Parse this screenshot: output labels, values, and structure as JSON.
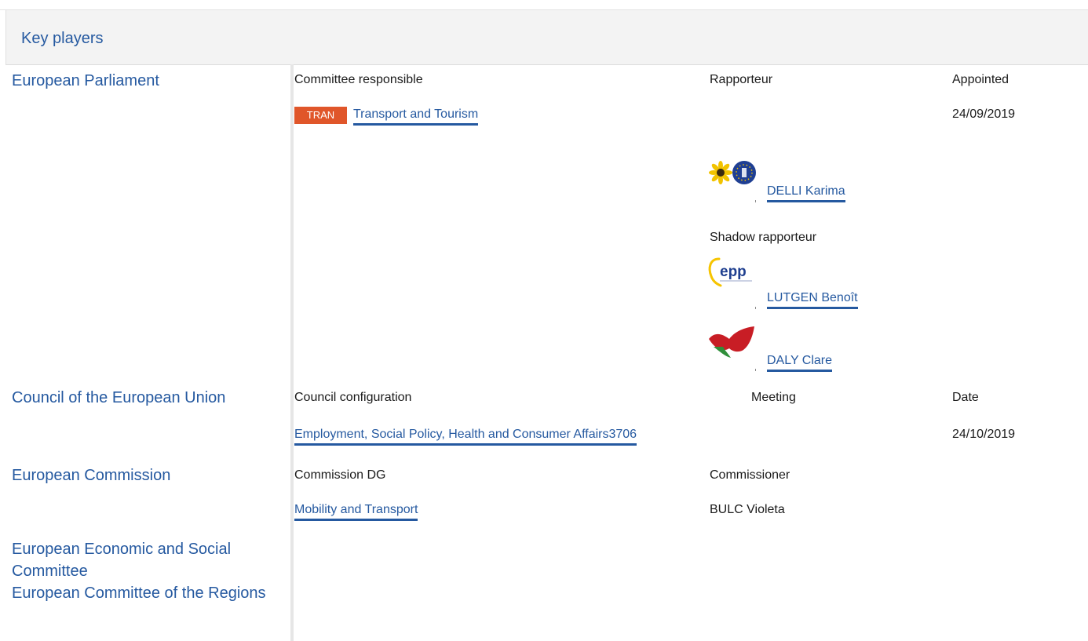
{
  "header": {
    "title": "Key players"
  },
  "institutions": {
    "ep": "European Parliament",
    "council": "Council of the European Union",
    "commission": "European Commission",
    "eesc": "European Economic and Social Committee",
    "cor": "European Committee of the Regions"
  },
  "ep": {
    "col_committee": "Committee responsible",
    "col_rapporteur": "Rapporteur",
    "col_appointed": "Appointed",
    "committee_badge": "TRAN",
    "committee_name": "Transport and Tourism",
    "appointed_date": "24/09/2019",
    "rapporteur": {
      "name": "DELLI Karima",
      "group_logo": "greens-efa-logo"
    },
    "shadow_label": "Shadow rapporteur",
    "shadows": [
      {
        "name": "LUTGEN Benoît",
        "group_logo": "epp-logo"
      },
      {
        "name": "DALY Clare",
        "group_logo": "gue-ngl-logo"
      }
    ],
    "badge_color": "#e0562a"
  },
  "council": {
    "col_config": "Council configuration",
    "col_meeting": "Meeting",
    "col_date": "Date",
    "config_link": "Employment, Social Policy, Health and Consumer Affairs3706",
    "date": "24/10/2019"
  },
  "commission": {
    "col_dg": "Commission DG",
    "col_commissioner": "Commissioner",
    "dg_link": "Mobility and Transport",
    "commissioner": "BULC Violeta"
  },
  "colors": {
    "link": "#2559a0",
    "header_bg": "#f3f3f3"
  }
}
